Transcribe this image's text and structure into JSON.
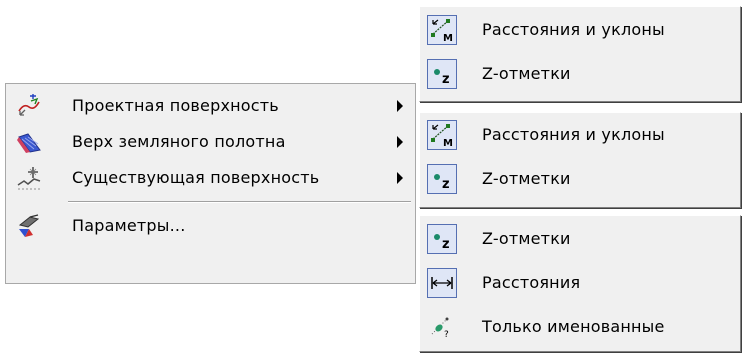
{
  "main_menu": {
    "items": [
      {
        "label": "Проектная поверхность",
        "icon": "design-surface-icon",
        "has_submenu": true
      },
      {
        "label": "Верх земляного полотна",
        "icon": "subgrade-top-icon",
        "has_submenu": true
      },
      {
        "label": "Существующая поверхность",
        "icon": "existing-surface-icon",
        "has_submenu": true
      },
      {
        "label": "Параметры...",
        "icon": "parameters-icon",
        "has_submenu": false
      }
    ]
  },
  "submenu_1": {
    "items": [
      {
        "label": "Расстояния и уклоны",
        "icon": "distances-slopes-icon",
        "checked": true
      },
      {
        "label": "Z-отметки",
        "icon": "z-marks-icon",
        "checked": true
      }
    ]
  },
  "submenu_2": {
    "items": [
      {
        "label": "Расстояния и уклоны",
        "icon": "distances-slopes-icon",
        "checked": true
      },
      {
        "label": "Z-отметки",
        "icon": "z-marks-icon",
        "checked": true
      }
    ]
  },
  "submenu_3": {
    "items": [
      {
        "label": "Z-отметки",
        "icon": "z-marks-icon",
        "checked": true
      },
      {
        "label": "Расстояния",
        "icon": "distances-icon",
        "checked": true
      },
      {
        "label": "Только именованные",
        "icon": "named-only-icon",
        "checked": false
      }
    ]
  },
  "colors": {
    "menu_background": "#f0f0f0",
    "checked_icon_frame": "#556fb2",
    "checked_icon_fill": "#dfe6f6"
  }
}
